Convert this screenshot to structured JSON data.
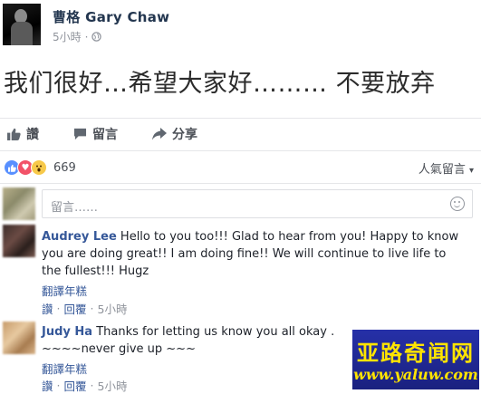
{
  "post": {
    "author": "曹格 Gary Chaw",
    "time": "5小時",
    "text": "我们很好…希望大家好……… 不要放弃"
  },
  "actions": {
    "like": "讚",
    "comment": "留言",
    "share": "分享"
  },
  "reactions": {
    "count": "669",
    "sort_label": "人氣留言",
    "sort_arrow": "▾"
  },
  "comment_input": {
    "placeholder": "留言……"
  },
  "comments": [
    {
      "name": "Audrey Lee",
      "text": "Hello to you too!!! Glad to hear from you! Happy to know you are doing great!! I am doing fine!! We will continue to live life to the fullest!!! Hugz",
      "translate": "翻譯年糕",
      "like": "讚",
      "reply": "回覆",
      "sep": "·",
      "time": "5小時"
    },
    {
      "name": "Judy Ha",
      "text": "Thanks for letting us know you all okay .",
      "text2": "~~~~never give up ~~~",
      "translate": "翻譯年糕",
      "like": "讚",
      "reply": "回覆",
      "sep": "·",
      "time": "5小時"
    }
  ],
  "watermark": {
    "title": "亚路奇闻网",
    "url": "www.yaluw.com"
  },
  "icons": {
    "audience": "globe-icon",
    "like": "thumbs-up-icon",
    "comment": "speech-bubble-icon",
    "share": "share-arrow-icon",
    "emoji": "smiley-icon"
  }
}
